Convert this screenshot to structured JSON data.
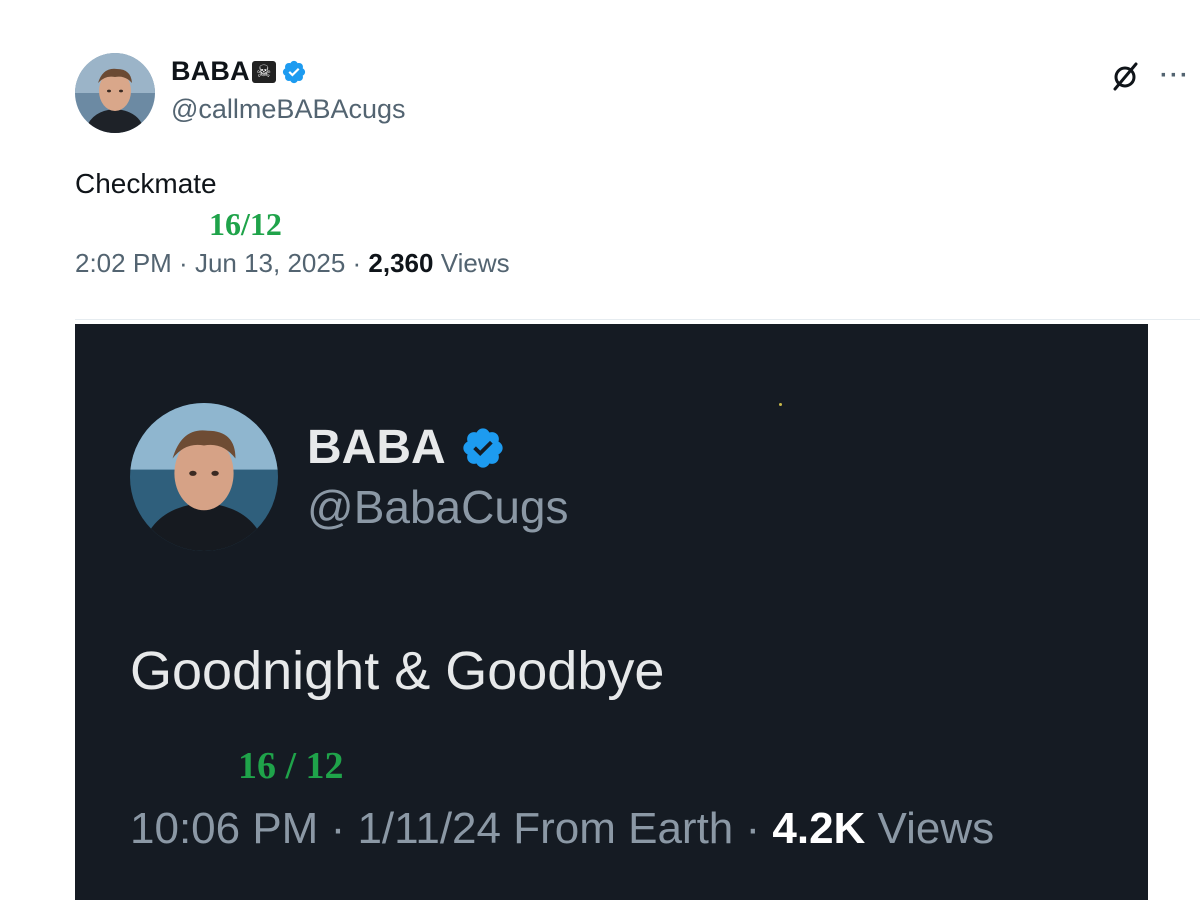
{
  "outer_tweet": {
    "display_name": "BABA",
    "name_emoji": "☠",
    "handle": "@callmeBABAcugs",
    "text": "Checkmate",
    "annotation": "16/12",
    "time": "2:02 PM",
    "separator": " · ",
    "date": "Jun 13, 2025",
    "views_count": "2,360",
    "views_label": " Views",
    "more_label": "···"
  },
  "quoted_screenshot": {
    "display_name": "BABA",
    "handle": "@BabaCugs",
    "text": "Goodnight & Goodbye",
    "annotation": "16 / 12",
    "time": "10:06 PM",
    "separator": " · ",
    "date_location": "1/11/24 From Earth",
    "views_count": "4.2K",
    "views_label": " Views"
  },
  "colors": {
    "verified_blue": "#1d9bf0",
    "annotation_green": "#1fa34a",
    "dark_background": "#151b23"
  },
  "icons": {
    "verified": "verified-badge-icon",
    "grok": "grok-icon",
    "more": "more-icon",
    "pirate_flag": "pirate-flag-icon"
  }
}
